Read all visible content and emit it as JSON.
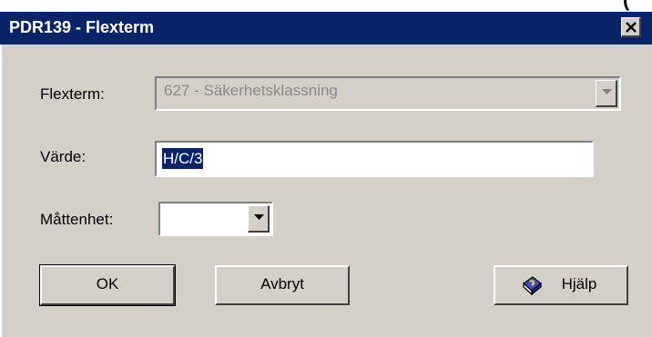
{
  "partial_glyph": "(",
  "window": {
    "title": "PDR139 - Flexterm",
    "close_icon": "close-icon"
  },
  "form": {
    "flexterm_label": "Flexterm:",
    "flexterm_value": "627 - Säkerhetsklassning",
    "varde_label": "Värde:",
    "varde_value": "H/C/3",
    "mattenhet_label": "Måttenhet:",
    "mattenhet_value": ""
  },
  "buttons": {
    "ok": "OK",
    "cancel": "Avbryt",
    "help": "Hjälp",
    "help_icon": "help-book-icon"
  },
  "colors": {
    "titlebar": "#0a246a",
    "face": "#d4d0c8",
    "selection": "#0a246a"
  }
}
